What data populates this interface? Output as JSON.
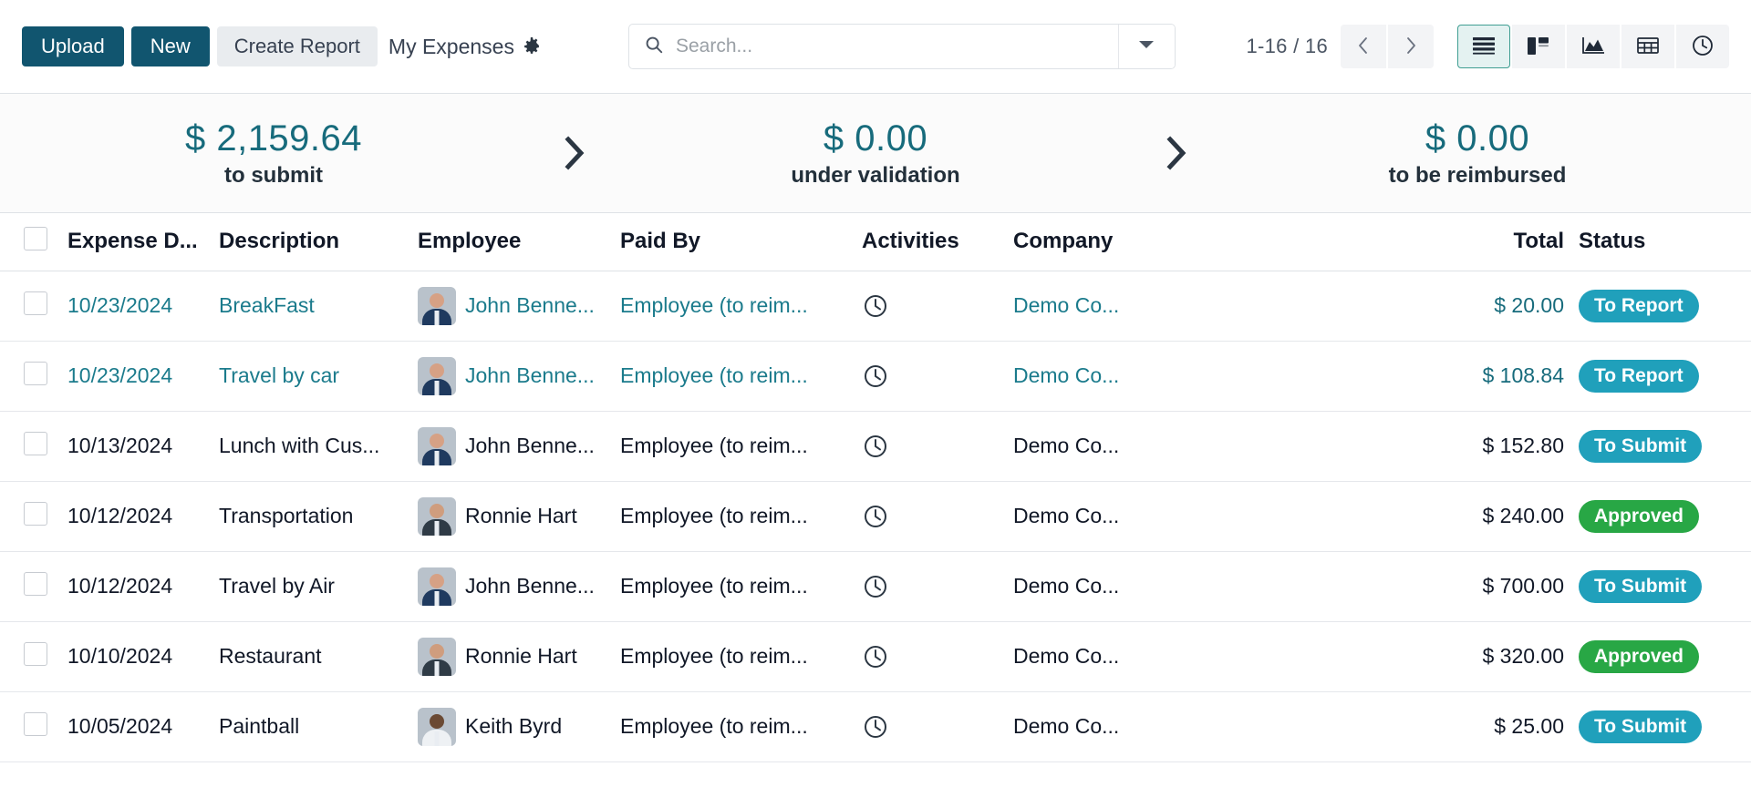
{
  "toolbar": {
    "upload_label": "Upload",
    "new_label": "New",
    "create_report_label": "Create Report",
    "breadcrumb_title": "My Expenses"
  },
  "search": {
    "placeholder": "Search...",
    "value": ""
  },
  "pager": {
    "range": "1-16 / 16"
  },
  "views": [
    {
      "name": "list",
      "label": "List",
      "active": true
    },
    {
      "name": "kanban",
      "label": "Kanban",
      "active": false
    },
    {
      "name": "graph",
      "label": "Graph",
      "active": false
    },
    {
      "name": "pivot",
      "label": "Pivot",
      "active": false
    },
    {
      "name": "activity",
      "label": "Activity",
      "active": false
    }
  ],
  "summary": [
    {
      "amount": "$ 2,159.64",
      "label": "to submit"
    },
    {
      "amount": "$ 0.00",
      "label": "under validation"
    },
    {
      "amount": "$ 0.00",
      "label": "to be reimbursed"
    }
  ],
  "table": {
    "columns": [
      "Expense D...",
      "Description",
      "Employee",
      "Paid By",
      "Activities",
      "Company",
      "Total",
      "Status"
    ],
    "rows": [
      {
        "date": "10/23/2024",
        "description": "BreakFast",
        "employee": "John Benne...",
        "paid_by": "Employee (to reim...",
        "activity": "clock-icon",
        "company": "Demo Co...",
        "total": "$ 20.00",
        "status": "To Report",
        "status_color": "#20a0bb",
        "link_style": true,
        "avatar_skin": "#d6a185",
        "avatar_hair": "#2c2118",
        "avatar_body": "#1f3a5f"
      },
      {
        "date": "10/23/2024",
        "description": "Travel by car",
        "employee": "John Benne...",
        "paid_by": "Employee (to reim...",
        "activity": "clock-icon",
        "company": "Demo Co...",
        "total": "$ 108.84",
        "status": "To Report",
        "status_color": "#20a0bb",
        "link_style": true,
        "avatar_skin": "#d6a185",
        "avatar_hair": "#2c2118",
        "avatar_body": "#1f3a5f"
      },
      {
        "date": "10/13/2024",
        "description": "Lunch with Cus...",
        "employee": "John Benne...",
        "paid_by": "Employee (to reim...",
        "activity": "clock-icon",
        "company": "Demo Co...",
        "total": "$ 152.80",
        "status": "To Submit",
        "status_color": "#20a0bb",
        "link_style": false,
        "avatar_skin": "#d6a185",
        "avatar_hair": "#2c2118",
        "avatar_body": "#1f3a5f"
      },
      {
        "date": "10/12/2024",
        "description": "Transportation",
        "employee": "Ronnie Hart",
        "paid_by": "Employee (to reim...",
        "activity": "clock-icon",
        "company": "Demo Co...",
        "total": "$ 240.00",
        "status": "Approved",
        "status_color": "#28a745",
        "link_style": false,
        "avatar_skin": "#cf9d7e",
        "avatar_hair": "#3a2a1d",
        "avatar_body": "#2f3b46"
      },
      {
        "date": "10/12/2024",
        "description": "Travel by Air",
        "employee": "John Benne...",
        "paid_by": "Employee (to reim...",
        "activity": "clock-icon",
        "company": "Demo Co...",
        "total": "$ 700.00",
        "status": "To Submit",
        "status_color": "#20a0bb",
        "link_style": false,
        "avatar_skin": "#d6a185",
        "avatar_hair": "#2c2118",
        "avatar_body": "#1f3a5f"
      },
      {
        "date": "10/10/2024",
        "description": "Restaurant",
        "employee": "Ronnie Hart",
        "paid_by": "Employee (to reim...",
        "activity": "clock-icon",
        "company": "Demo Co...",
        "total": "$ 320.00",
        "status": "Approved",
        "status_color": "#28a745",
        "link_style": false,
        "avatar_skin": "#cf9d7e",
        "avatar_hair": "#3a2a1d",
        "avatar_body": "#2f3b46"
      },
      {
        "date": "10/05/2024",
        "description": "Paintball",
        "employee": "Keith Byrd",
        "paid_by": "Employee (to reim...",
        "activity": "clock-icon",
        "company": "Demo Co...",
        "total": "$ 25.00",
        "status": "To Submit",
        "status_color": "#20a0bb",
        "link_style": false,
        "avatar_skin": "#6b4a34",
        "avatar_hair": "#150f0b",
        "avatar_body": "#eef1f4"
      }
    ]
  },
  "colors": {
    "primary": "#11556f",
    "link": "#1b7b8c",
    "summary_amount": "#176b7c",
    "badge_teal": "#20a0bb",
    "badge_green": "#28a745",
    "view_active_bg": "#e4f2f1",
    "view_active_border": "#3f9e92"
  }
}
